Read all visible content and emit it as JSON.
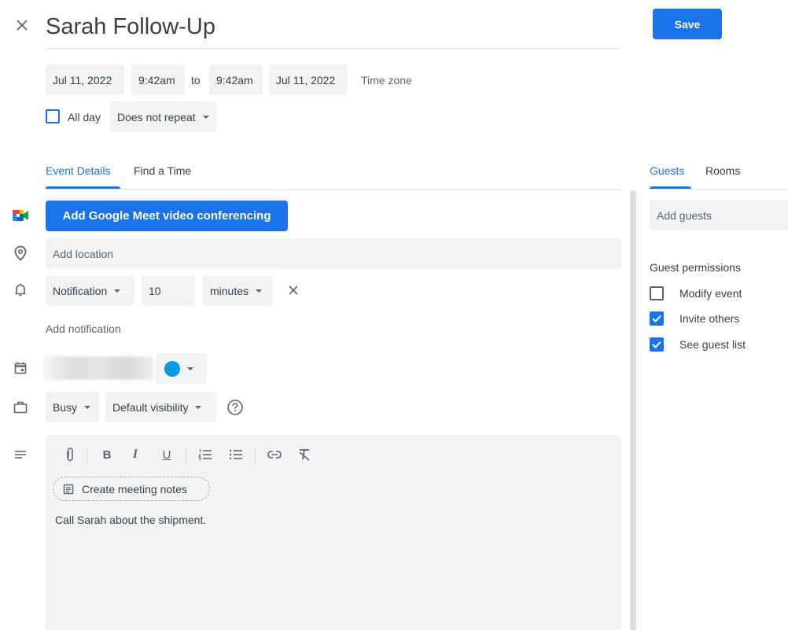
{
  "header": {
    "title": "Sarah Follow-Up",
    "save_label": "Save",
    "close_icon": "close-icon"
  },
  "datetime": {
    "start_date": "Jul 11, 2022",
    "start_time": "9:42am",
    "to_label": "to",
    "end_time": "9:42am",
    "end_date": "Jul 11, 2022",
    "time_zone_label": "Time zone",
    "all_day_label": "All day",
    "all_day_checked": false,
    "repeat_value": "Does not repeat"
  },
  "tabs": {
    "left": [
      {
        "label": "Event Details",
        "active": true
      },
      {
        "label": "Find a Time",
        "active": false
      }
    ],
    "right": [
      {
        "label": "Guests",
        "active": true
      },
      {
        "label": "Rooms",
        "active": false
      }
    ]
  },
  "details": {
    "meet_button_label": "Add Google Meet video conferencing",
    "location_placeholder": "Add location",
    "notification": {
      "type": "Notification",
      "amount": "10",
      "unit": "minutes"
    },
    "add_notification_label": "Add notification",
    "calendar_color": "#039be5",
    "availability": "Busy",
    "visibility": "Default visibility",
    "toolbar": [
      "attach",
      "bold",
      "italic",
      "underline",
      "numbered-list",
      "bulleted-list",
      "link",
      "remove-formatting"
    ],
    "create_notes_label": "Create meeting notes",
    "description": "Call Sarah about the shipment."
  },
  "guests": {
    "add_guests_placeholder": "Add guests",
    "permissions_title": "Guest permissions",
    "permissions": [
      {
        "label": "Modify event",
        "checked": false
      },
      {
        "label": "Invite others",
        "checked": true
      },
      {
        "label": "See guest list",
        "checked": true
      }
    ]
  },
  "colors": {
    "accent": "#1a73e8",
    "field_bg": "#f1f3f4",
    "text": "#3c4043"
  }
}
